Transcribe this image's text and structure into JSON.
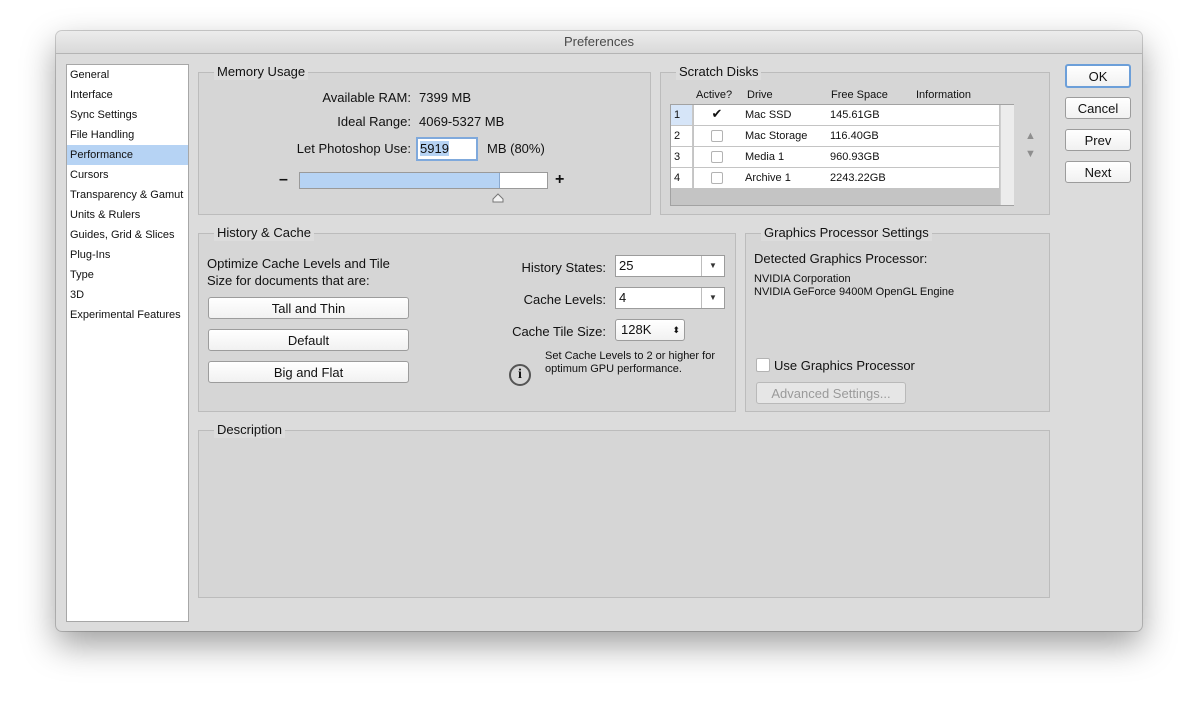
{
  "window": {
    "title": "Preferences"
  },
  "sidebar": {
    "items": [
      {
        "label": "General"
      },
      {
        "label": "Interface"
      },
      {
        "label": "Sync Settings"
      },
      {
        "label": "File Handling"
      },
      {
        "label": "Performance"
      },
      {
        "label": "Cursors"
      },
      {
        "label": "Transparency & Gamut"
      },
      {
        "label": "Units & Rulers"
      },
      {
        "label": "Guides, Grid & Slices"
      },
      {
        "label": "Plug-Ins"
      },
      {
        "label": "Type"
      },
      {
        "label": "3D"
      },
      {
        "label": "Experimental Features"
      }
    ],
    "selected": "Performance"
  },
  "memory": {
    "title": "Memory Usage",
    "available_label": "Available RAM:",
    "available_value": "7399 MB",
    "ideal_label": "Ideal Range:",
    "ideal_value": "4069-5327 MB",
    "let_label": "Let Photoshop Use:",
    "let_value": "5919",
    "let_unit": "MB (80%)",
    "minus": "–",
    "plus": "+",
    "slider_percent": 80
  },
  "scratch": {
    "title": "Scratch Disks",
    "headers": {
      "active": "Active?",
      "drive": "Drive",
      "free": "Free Space",
      "info": "Information"
    },
    "rows": [
      {
        "num": "1",
        "checked": "✔",
        "drive": "Mac SSD",
        "free": "145.61GB",
        "info": ""
      },
      {
        "num": "2",
        "checked": "",
        "drive": "Mac Storage",
        "free": "116.40GB",
        "info": ""
      },
      {
        "num": "3",
        "checked": "",
        "drive": "Media 1",
        "free": "960.93GB",
        "info": ""
      },
      {
        "num": "4",
        "checked": "",
        "drive": "Archive 1",
        "free": "2243.22GB",
        "info": ""
      }
    ],
    "up_arrow": "▲",
    "down_arrow": "▼"
  },
  "history": {
    "title": "History & Cache",
    "optimize_line1": "Optimize Cache Levels and Tile",
    "optimize_line2": "Size for documents that are:",
    "btn_tall": "Tall and Thin",
    "btn_default": "Default",
    "btn_big": "Big and Flat",
    "states_label": "History States:",
    "states_value": "25",
    "levels_label": "Cache Levels:",
    "levels_value": "4",
    "tile_label": "Cache Tile Size:",
    "tile_value": "128K",
    "tip_line1": "Set Cache Levels to 2 or higher for",
    "tip_line2": "optimum GPU performance.",
    "info_glyph": "i"
  },
  "gpu": {
    "title": "Graphics Processor Settings",
    "detected_label": "Detected Graphics Processor:",
    "vendor": "NVIDIA Corporation",
    "engine": "NVIDIA GeForce 9400M OpenGL Engine",
    "use_label": "Use Graphics Processor",
    "advanced": "Advanced Settings..."
  },
  "description": {
    "title": "Description"
  },
  "buttons": {
    "ok": "OK",
    "cancel": "Cancel",
    "prev": "Prev",
    "next": "Next"
  },
  "colors": {
    "selection": "#b6d3f4",
    "slider_fill": "#b6d3f4",
    "window_bg": "#dcdcdc"
  }
}
